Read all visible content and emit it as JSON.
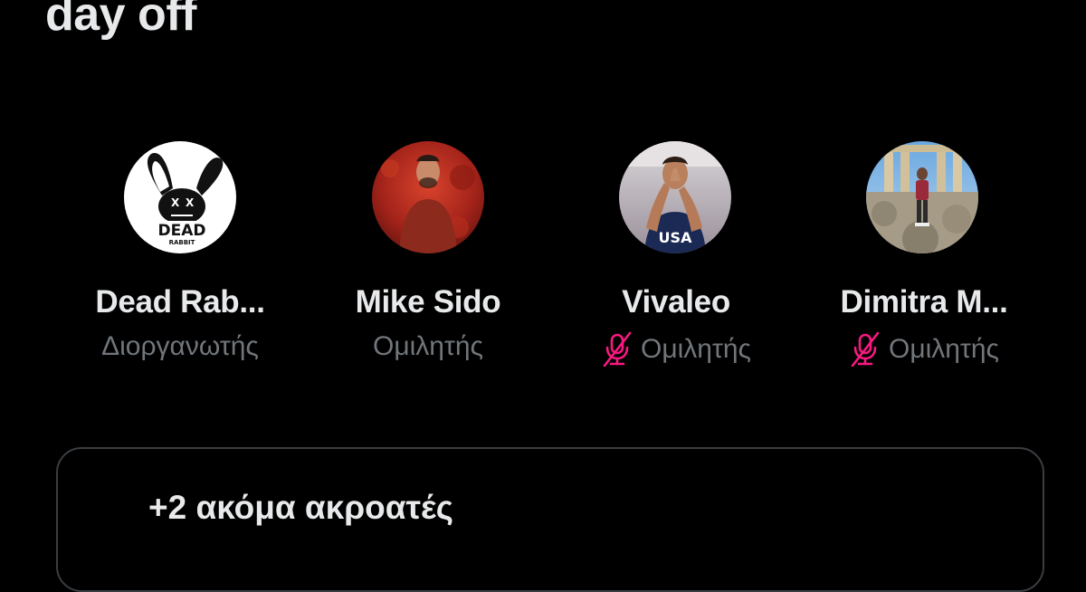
{
  "space": {
    "title": "day off"
  },
  "participants": [
    {
      "name": "Dead Rab...",
      "role": "Διοργανωτής",
      "muted": false,
      "avatar": "dead-rabbit-logo-avatar"
    },
    {
      "name": "Mike Sido",
      "role": "Ομιλητής",
      "muted": false,
      "avatar": "mike-sido-photo-avatar"
    },
    {
      "name": "Vivaleo",
      "role": "Ομιλητής",
      "muted": true,
      "avatar": "vivaleo-photo-avatar"
    },
    {
      "name": "Dimitra M...",
      "role": "Ομιλητής",
      "muted": true,
      "avatar": "dimitra-photo-avatar"
    }
  ],
  "listeners": {
    "label": "+2 ακόμα ακροατές"
  },
  "colors": {
    "background": "#000000",
    "primary_text": "#e7e9ea",
    "secondary_text": "#71767b",
    "muted_icon": "#f91880",
    "button_border": "#3a3d41"
  }
}
